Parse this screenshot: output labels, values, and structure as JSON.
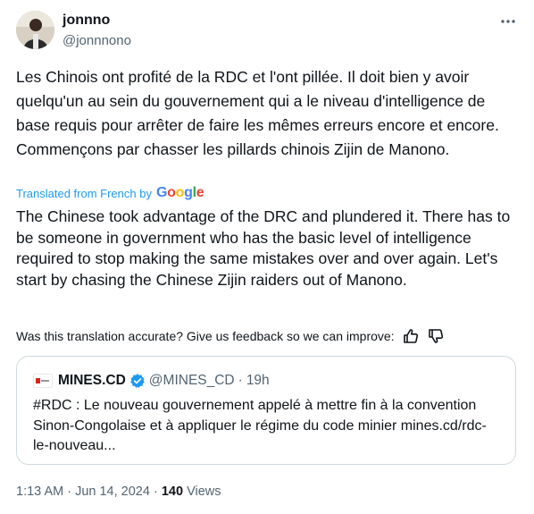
{
  "tweet": {
    "author": {
      "display_name": "jonnno",
      "handle": "@jonnnono"
    },
    "text": "Les Chinois ont profité de la RDC et l'ont pillée. Il doit bien y avoir quelqu'un au sein du gouvernement qui a le niveau d'intelligence de base requis pour arrêter de faire les mêmes erreurs encore et encore. Commençons par chasser les pillards chinois Zijin de Manono.",
    "translated_label": "Translated from French by",
    "google_label": "Google",
    "translation": "The Chinese took advantage of the DRC and plundered it. There has to be someone in government who has the basic level of intelligence required to stop making the same mistakes over and over again. Let's start by chasing the Chinese Zijin raiders out of Manono.",
    "feedback_prompt": "Was this translation accurate? Give us feedback so we can improve:",
    "quote": {
      "name": "MINES.CD",
      "handle": "@MINES_CD",
      "dot": "·",
      "time": "19h",
      "text": "#RDC : Le nouveau gouvernement appelé à mettre fin à la convention Sinon-Congolaise et à appliquer le régime du code minier mines.cd/rdc-le-nouveau..."
    },
    "timestamp": "1:13 AM · Jun 14, 2024 ·",
    "views_count": "140",
    "views_label": "Views"
  },
  "colors": {
    "link": "#1d9bf0",
    "muted": "#536471",
    "border": "#cfd9de",
    "verified": "#1d9bf0"
  }
}
